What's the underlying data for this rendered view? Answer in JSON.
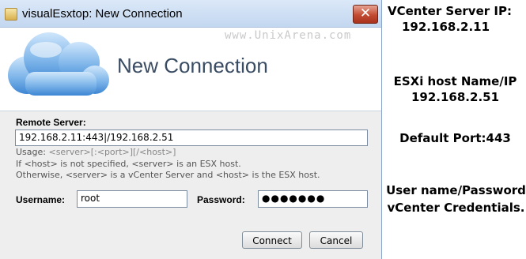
{
  "window": {
    "title": "visualEsxtop: New Connection",
    "close_glyph": "✕",
    "icon": "app-icon"
  },
  "header": {
    "watermark": "www.UnixArena.com",
    "title": "New Connection",
    "logo_icon": "cloud-icon"
  },
  "form": {
    "remote_server_label": "Remote Server:",
    "remote_server_value": "192.168.2.11:443|/192.168.2.51",
    "usage_key": "Usage:",
    "usage_text": "<server>[:<port>][/<host>]",
    "help_line1": "If <host> is not specified, <server> is an ESX host.",
    "help_line2": "Otherwise, <server> is a vCenter Server and <host> is the ESX host.",
    "username_label": "Username:",
    "username_value": "root",
    "password_label": "Password:",
    "password_value": "●●●●●●●"
  },
  "buttons": {
    "connect": "Connect",
    "cancel": "Cancel"
  },
  "annotations": {
    "vcenter_line1": "VCenter Server IP:",
    "vcenter_line2": "192.168.2.11",
    "esxi_line1": "ESXi host Name/IP",
    "esxi_line2": "192.168.2.51",
    "port": "Default Port:443",
    "cred_line1": "User name/Password",
    "cred_line2": "vCenter Credentials."
  },
  "colors": {
    "titlebar": "#c3d7f0",
    "close_button": "#c24b32",
    "header_title": "#3a4c63"
  }
}
